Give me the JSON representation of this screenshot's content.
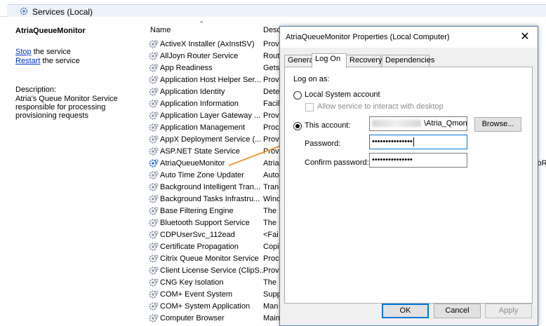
{
  "header": {
    "title": "Services (Local)"
  },
  "left_pane": {
    "service_name": "AtriaQueueMonitor",
    "stop_link": "Stop",
    "stop_suffix": " the service",
    "restart_link": "Restart",
    "restart_suffix": " the service",
    "description_label": "Description:",
    "description": "Atria's Queue Monitor Service responsible for processing provisioning requests"
  },
  "list": {
    "columns": {
      "name": "Name",
      "description": "Desc"
    },
    "sort_indicator": "^",
    "rows": [
      {
        "name": "ActiveX Installer (AxInstSV)",
        "desc": "Prov"
      },
      {
        "name": "AllJoyn Router Service",
        "desc": "Rout"
      },
      {
        "name": "App Readiness",
        "desc": "Gets"
      },
      {
        "name": "Application Host Helper Ser...",
        "desc": "Prov"
      },
      {
        "name": "Application Identity",
        "desc": "Dete"
      },
      {
        "name": "Application Information",
        "desc": "Facil"
      },
      {
        "name": "Application Layer Gateway ...",
        "desc": "Prov"
      },
      {
        "name": "Application Management",
        "desc": "Proc"
      },
      {
        "name": "AppX Deployment Service (...",
        "desc": "Prov"
      },
      {
        "name": "ASP.NET State Service",
        "desc": "Prov"
      },
      {
        "name": "AtriaQueueMonitor",
        "desc": "Atria"
      },
      {
        "name": "Auto Time Zone Updater",
        "desc": "Auto"
      },
      {
        "name": "Background Intelligent Tran...",
        "desc": "Tran"
      },
      {
        "name": "Background Tasks Infrastru...",
        "desc": "Wind"
      },
      {
        "name": "Base Filtering Engine",
        "desc": "The"
      },
      {
        "name": "Bluetooth Support Service",
        "desc": "The"
      },
      {
        "name": "CDPUserSvc_112ead",
        "desc": "<Fai"
      },
      {
        "name": "Certificate Propagation",
        "desc": "Copi"
      },
      {
        "name": "Citrix Queue Monitor Service",
        "desc": "Proc"
      },
      {
        "name": "Client License Service (ClipS...",
        "desc": "Prov"
      },
      {
        "name": "CNG Key Isolation",
        "desc": "The"
      },
      {
        "name": "COM+ Event System",
        "desc": "Supp"
      },
      {
        "name": "COM+ System Application",
        "desc": "Man"
      },
      {
        "name": "Computer Browser",
        "desc": "Main"
      }
    ],
    "right_edge_text": "cbR"
  },
  "dialog": {
    "title": "AtriaQueueMonitor Properties (Local Computer)",
    "close_glyph": "✕",
    "tabs": [
      "General",
      "Log On",
      "Recovery",
      "Dependencies"
    ],
    "active_tab": "Log On",
    "logon_as_label": "Log on as:",
    "local_system_label": "Local System account",
    "allow_interact_label": "Allow service to interact with desktop",
    "this_account_label": "This account:",
    "account_value": "\\Atria_Qmon_s",
    "browse_label": "Browse...",
    "password_label": "Password:",
    "password_value": "•••••••••••••••",
    "confirm_label": "Confirm password:",
    "confirm_value": "•••••••••••••••",
    "ok_label": "OK",
    "cancel_label": "Cancel",
    "apply_label": "Apply"
  },
  "colors": {
    "link": "#0033cc",
    "arrow": "#e89a3c",
    "focus_border": "#0078d7",
    "header_bg": "#eef3fb"
  },
  "icons": {
    "service": "gear-icon"
  }
}
